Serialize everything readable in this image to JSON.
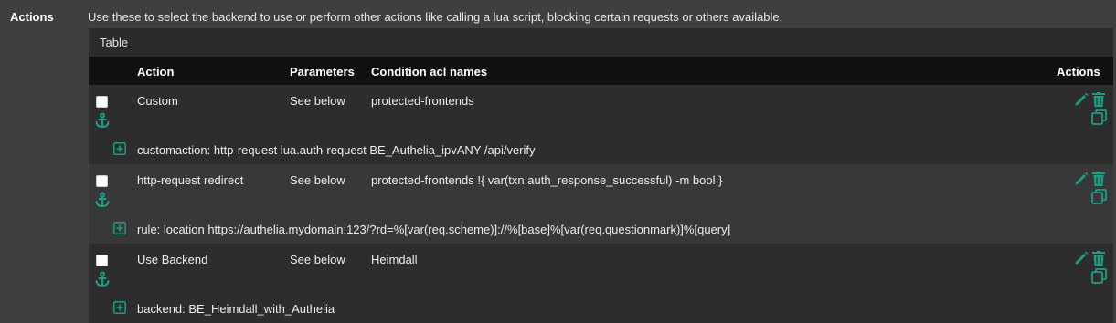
{
  "section": {
    "label": "Actions",
    "description": "Use these to select the backend to use or perform other actions like calling a lua script, blocking certain requests or others available."
  },
  "panel": {
    "title": "Table",
    "headers": {
      "action": "Action",
      "parameters": "Parameters",
      "condition": "Condition acl names",
      "actions": "Actions"
    }
  },
  "rows": [
    {
      "action": "Custom",
      "parameters": "See below",
      "condition": "protected-frontends",
      "detail": "customaction: http-request lua.auth-request BE_Authelia_ipvANY /api/verify"
    },
    {
      "action": "http-request redirect",
      "parameters": "See below",
      "condition": "protected-frontends !{ var(txn.auth_response_successful) -m bool }",
      "detail": "rule: location https://authelia.mydomain:123/?rd=%[var(req.scheme)]://%[base]%[var(req.questionmark)]%[query]"
    },
    {
      "action": "Use Backend",
      "parameters": "See below",
      "condition": "Heimdall",
      "detail": "backend: BE_Heimdall_with_Authelia"
    }
  ],
  "colors": {
    "accent": "#16a085",
    "header_bg": "#111111",
    "panel_bg": "#2b2b2b",
    "page_bg": "#3f3f3f"
  },
  "icons": [
    "anchor-icon",
    "pencil-icon",
    "trash-icon",
    "copy-icon",
    "plus-square-icon"
  ]
}
